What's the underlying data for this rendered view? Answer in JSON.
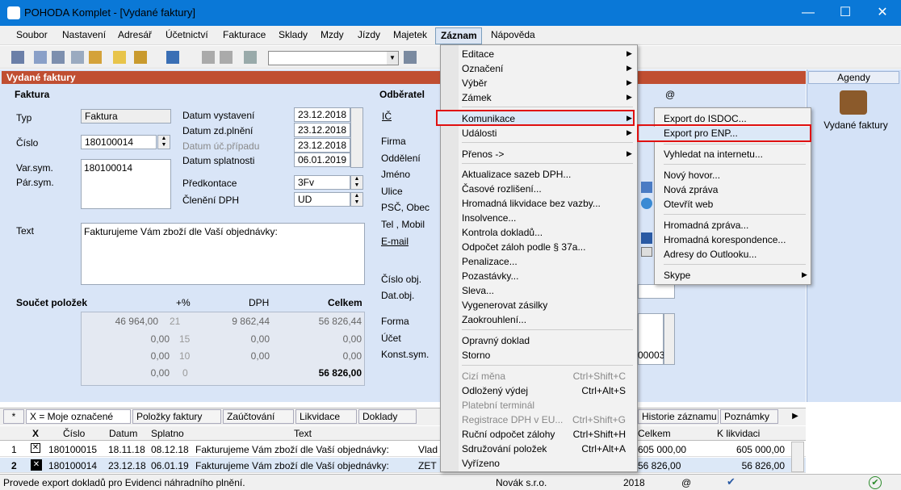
{
  "window": {
    "title": "POHODA Komplet - [Vydané faktury]",
    "minimize": "—",
    "maximize": "☐",
    "close": "✕"
  },
  "menu": [
    "Soubor",
    "Nastavení",
    "Adresář",
    "Účetnictví",
    "Fakturace",
    "Sklady",
    "Mzdy",
    "Jízdy",
    "Majetek",
    "Záznam",
    "Nápověda"
  ],
  "doc_title": "Vydané faktury",
  "agendy": {
    "header": "Agendy",
    "item": "Vydané faktury"
  },
  "faktura": {
    "section": "Faktura",
    "typ_label": "Typ",
    "typ_value": "Faktura",
    "cislo_label": "Číslo",
    "cislo_value": "180100014",
    "varsym_label": "Var.sym.",
    "varsym_value": "180100014",
    "parsym_label": "Pár.sym.",
    "datum_vystaveni_label": "Datum vystavení",
    "datum_vystaveni": "23.12.2018",
    "datum_zdplneni_label": "Datum zd.plnění",
    "datum_zdplneni": "23.12.2018",
    "datum_ucpripadu_label": "Datum úč.případu",
    "datum_ucpripadu": "23.12.2018",
    "datum_splatnosti_label": "Datum splatnosti",
    "datum_splatnosti": "06.01.2019",
    "predkontace_label": "Předkontace",
    "predkontace": "3Fv",
    "cleneni_label": "Členění DPH",
    "cleneni": "UD",
    "text_label": "Text",
    "text_value": "Fakturujeme Vám zboží dle Vaší objednávky:"
  },
  "odberatel": {
    "section": "Odběratel",
    "ic": "IČ",
    "firma": "Firma",
    "oddeleni": "Oddělení",
    "jmeno": "Jméno",
    "ulice": "Ulice",
    "psc": "PSČ, Obec",
    "tel": "Tel , Mobil",
    "email": "E-mail",
    "cislo_obj": "Číslo obj.",
    "dat_obj": "Dat.obj.",
    "forma": "Forma",
    "ucet": "Účet",
    "konst": "Konst.sym.",
    "konst_tail": "00003",
    "at": "@"
  },
  "soucet": {
    "label": "Součet položek",
    "h_pct": "+%",
    "h_dph": "DPH",
    "h_celkem": "Celkem",
    "rows": [
      {
        "base": "46 964,00",
        "pct": "21",
        "dph": "9 862,44",
        "celkem": "56 826,44"
      },
      {
        "base": "0,00",
        "pct": "15",
        "dph": "0,00",
        "celkem": "0,00"
      },
      {
        "base": "0,00",
        "pct": "10",
        "dph": "0,00",
        "celkem": "0,00"
      },
      {
        "base": "0,00",
        "pct": "0",
        "dph": "",
        "celkem": "56 826,00"
      }
    ]
  },
  "tabs": [
    "*",
    "X = Moje označené",
    "Položky faktury",
    "Zaúčtování",
    "Likvidace",
    "Doklady",
    "Historie záznamu",
    "Poznámky"
  ],
  "grid": {
    "headers": [
      "X",
      "Číslo",
      "Datum",
      "Splatno",
      "Text",
      "Celkem",
      "K likvidaci"
    ],
    "rows": [
      {
        "n": "1",
        "cislo": "180100015",
        "datum": "18.11.18",
        "splatno": "08.12.18",
        "text": "Fakturujeme Vám zboží dle Vaší objednávky:",
        "extra": "Vlad",
        "celkem": "605 000,00",
        "klik": "605 000,00"
      },
      {
        "n": "2",
        "cislo": "180100014",
        "datum": "23.12.18",
        "splatno": "06.01.19",
        "text": "Fakturujeme Vám zboží dle Vaší objednávky:",
        "extra": "ZET",
        "celkem": "56 826,00",
        "klik": "56 826,00"
      }
    ]
  },
  "status": {
    "text": "Provede export dokladů pro Evidenci náhradního plnění.",
    "company": "Novák s.r.o.",
    "year": "2018",
    "at": "@"
  },
  "dropdown": [
    {
      "label": "Editace",
      "arrow": "▶"
    },
    {
      "label": "Označení",
      "arrow": "▶"
    },
    {
      "label": "Výběr",
      "arrow": "▶"
    },
    {
      "label": "Zámek",
      "arrow": "▶"
    },
    {
      "label": "Komunikace",
      "arrow": "▶"
    },
    {
      "label": "Události",
      "arrow": "▶"
    },
    {
      "label": "Přenos ->",
      "arrow": "▶"
    },
    {
      "label": "Aktualizace sazeb DPH..."
    },
    {
      "label": "Časové rozlišení..."
    },
    {
      "label": "Hromadná likvidace bez vazby..."
    },
    {
      "label": "Insolvence..."
    },
    {
      "label": "Kontrola dokladů..."
    },
    {
      "label": "Odpočet záloh podle § 37a..."
    },
    {
      "label": "Penalizace..."
    },
    {
      "label": "Pozastávky..."
    },
    {
      "label": "Sleva..."
    },
    {
      "label": "Vygenerovat zásilky"
    },
    {
      "label": "Zaokrouhlení..."
    },
    {
      "label": "Opravný doklad"
    },
    {
      "label": "Storno"
    },
    {
      "label": "Cizí měna",
      "shortcut": "Ctrl+Shift+C",
      "disabled": true
    },
    {
      "label": "Odložený výdej",
      "shortcut": "Ctrl+Alt+S"
    },
    {
      "label": "Platební terminál",
      "disabled": true
    },
    {
      "label": "Registrace DPH v EU...",
      "shortcut": "Ctrl+Shift+G",
      "disabled": true
    },
    {
      "label": "Ruční odpočet zálohy",
      "shortcut": "Ctrl+Shift+H"
    },
    {
      "label": "Sdružování položek",
      "shortcut": "Ctrl+Alt+A"
    },
    {
      "label": "Vyřízeno"
    }
  ],
  "submenu": [
    {
      "label": "Export do ISDOC..."
    },
    {
      "label": "Export pro ENP..."
    },
    {
      "label": "Vyhledat na internetu..."
    },
    {
      "label": "Nový hovor..."
    },
    {
      "label": "Nová zpráva"
    },
    {
      "label": "Otevřít web"
    },
    {
      "label": "Hromadná zpráva..."
    },
    {
      "label": "Hromadná korespondence..."
    },
    {
      "label": "Adresy do Outlooku..."
    },
    {
      "label": "Skype",
      "arrow": "▶"
    }
  ],
  "colors": {
    "titlebar": "#0a78d7",
    "doc_header": "#c04e32",
    "highlight_border": "#e01010"
  }
}
